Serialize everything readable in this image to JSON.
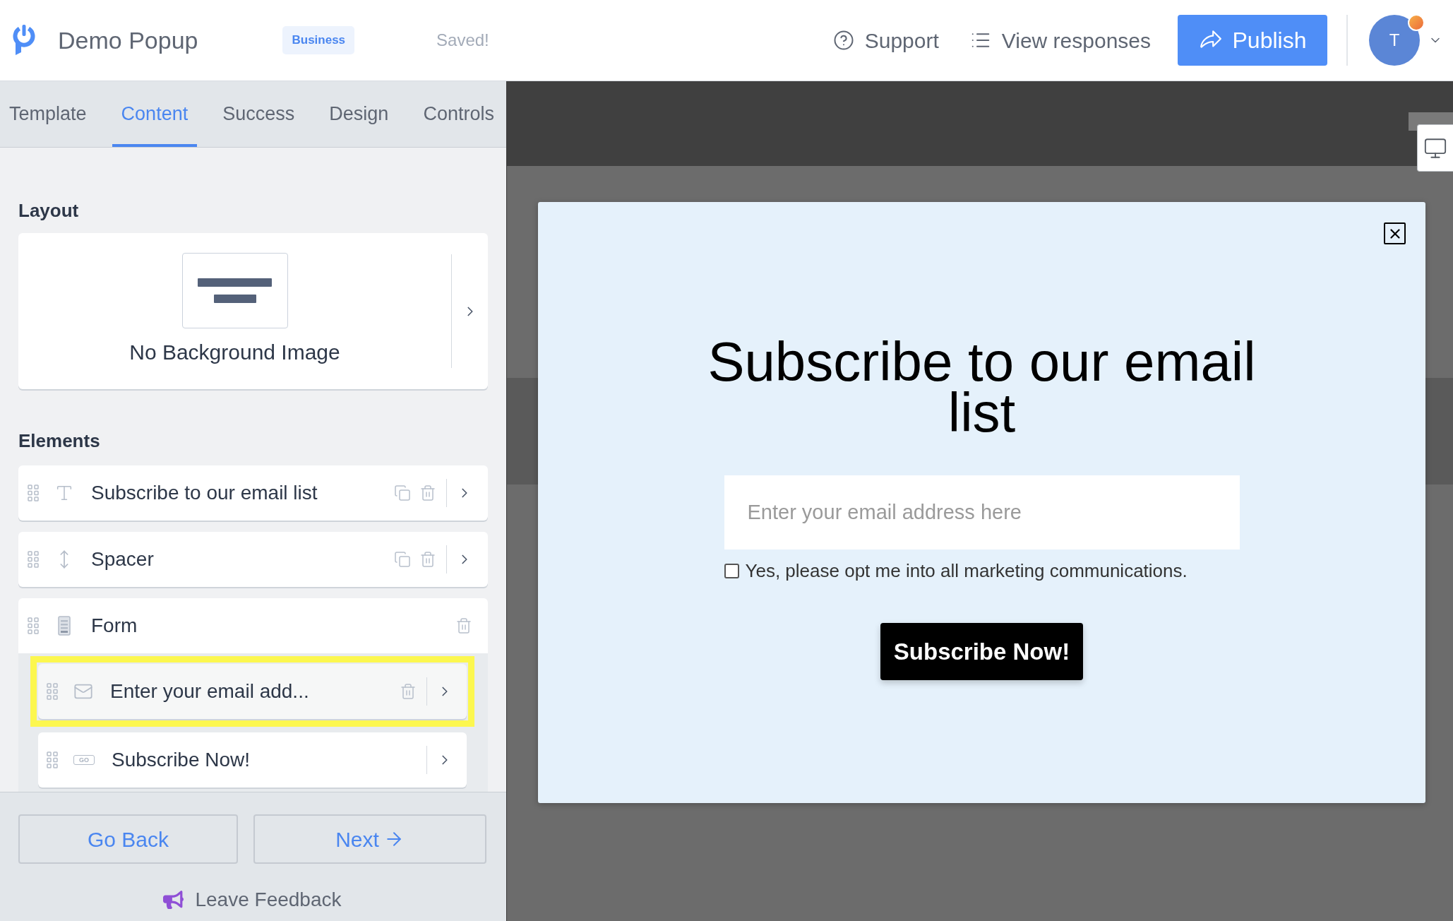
{
  "header": {
    "title": "Demo Popup",
    "plan_badge": "Business",
    "save_status": "Saved!",
    "links": [
      {
        "kind": "help",
        "label": "Support"
      },
      {
        "kind": "responses",
        "label": "View responses"
      }
    ],
    "publish_button": "Publish",
    "avatar": {
      "initial": "T",
      "notification": true
    }
  },
  "sidebar": {
    "tabs": [
      {
        "label": "Template",
        "selected": false
      },
      {
        "label": "Content",
        "selected": true
      },
      {
        "label": "Success",
        "selected": false
      },
      {
        "label": "Design",
        "selected": false
      },
      {
        "label": "Controls",
        "selected": false
      }
    ],
    "layout": {
      "heading": "Layout",
      "background_label": "No Background Image"
    },
    "elements": {
      "heading": "Elements",
      "items": [
        {
          "kind": "text",
          "label": "Subscribe to our email list",
          "copyable": true,
          "deletable": true,
          "expandable": true,
          "highlighted": false
        },
        {
          "kind": "spacer",
          "label": "Spacer",
          "copyable": true,
          "deletable": true,
          "expandable": true,
          "highlighted": false
        },
        {
          "kind": "form",
          "label": "Form",
          "copyable": false,
          "deletable": true,
          "expandable": false,
          "highlighted": false,
          "children": [
            {
              "kind": "email",
              "label": "Enter your email add...",
              "copyable": false,
              "deletable": true,
              "expandable": true,
              "highlighted": true
            },
            {
              "kind": "button",
              "label": "Subscribe Now!",
              "icon_label": "GO",
              "copyable": false,
              "deletable": false,
              "expandable": true,
              "highlighted": false
            }
          ]
        }
      ]
    },
    "footer": {
      "back_button": "Go Back",
      "next_button": "Next",
      "feedback_link": "Leave Feedback"
    }
  },
  "preview": {
    "popup": {
      "heading": "Subscribe to our email list",
      "email_placeholder": "Enter your email address here",
      "consent": {
        "label": "Yes, please opt me into all marketing communications.",
        "checked": false
      },
      "submit_button": "Subscribe Now!"
    }
  }
}
